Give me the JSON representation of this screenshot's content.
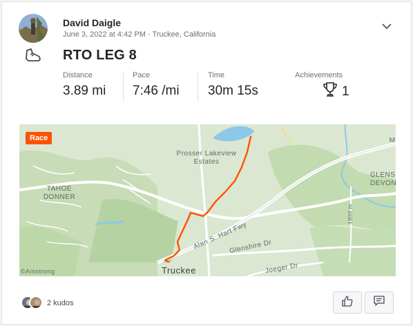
{
  "athlete": {
    "name": "David Daigle",
    "meta": "June 3, 2022 at 4:42 PM · Truckee, California"
  },
  "activity": {
    "title": "RTO LEG 8",
    "sport_icon": "running-shoe-icon"
  },
  "stats": {
    "distance": {
      "label": "Distance",
      "value": "3.89 mi"
    },
    "pace": {
      "label": "Pace",
      "value": "7:46 /mi"
    },
    "time": {
      "label": "Time",
      "value": "30m 15s"
    },
    "achievements": {
      "label": "Achievements",
      "value": "1",
      "icon": "trophy-icon"
    }
  },
  "map": {
    "badge": "Race",
    "labels": {
      "prosser": "Prosser Lakeview Estates",
      "tahoe": "TAHOE DONNER",
      "glenshire_devon": "GLENSHIRE DEVON",
      "glens_right": "M",
      "freeway": "Alan S. Hart Fwy",
      "glenshire_dr": "Glenshire Dr",
      "joeger": "Joeger Dr",
      "truckee": "Truckee",
      "road_1800": "1800 m",
      "attribution": "©Amstrong"
    },
    "colors": {
      "route": "#fc5200",
      "water": "#8cc8e8",
      "park": "#b9d9a8",
      "road": "#ffffff"
    }
  },
  "kudos": {
    "count_label": "2 kudos"
  },
  "actions": {
    "kudo_icon": "thumbs-up-icon",
    "comment_icon": "comment-icon"
  },
  "colors": {
    "accent": "#fc5200",
    "text": "#242428",
    "muted": "#6d6d78"
  }
}
